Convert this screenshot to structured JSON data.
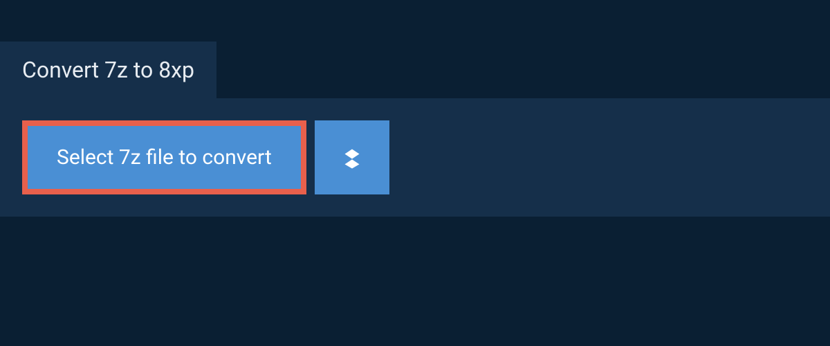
{
  "header": {
    "title": "Convert 7z to 8xp"
  },
  "actions": {
    "select_file_label": "Select 7z file to convert"
  }
}
